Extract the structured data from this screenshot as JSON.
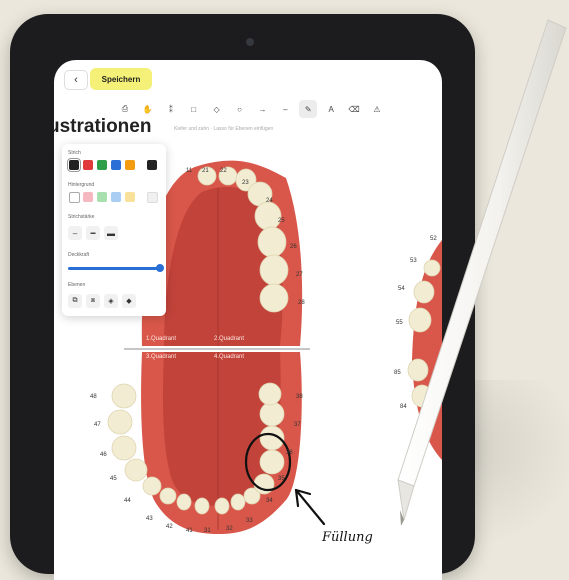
{
  "toolbar": {
    "back_glyph": "‹",
    "save_label": "Speichern",
    "tools": [
      "⎙",
      "✋",
      "⁑",
      "□",
      "◇",
      "○",
      "→",
      "–",
      "✎",
      "A",
      "⌫",
      "⚠"
    ],
    "hint": "Kiefer und zahn · Lasso für Ebenen einfügen"
  },
  "title": "ustrationen",
  "panel": {
    "stroke_label": "Strich",
    "stroke_colors": [
      "#222222",
      "#e03a3a",
      "#2e9e49",
      "#2a6fd6",
      "#f39c12",
      "#222222"
    ],
    "fill_label": "Hintergrund",
    "fill_colors": [
      "#ffffff",
      "#f6b8c0",
      "#a8e0b0",
      "#a9cdf3",
      "#f7e19b",
      "#f0f0f0"
    ],
    "width_label": "Strichstärke",
    "width_glyphs": [
      "–",
      "━",
      "▬"
    ],
    "opacity_label": "Deckkraft",
    "opacity_value": 1.0,
    "layers_label": "Ebenen",
    "layer_glyphs": [
      "⧉",
      "⧈",
      "◈",
      "◆"
    ]
  },
  "quadrants": [
    "1.Quadrant",
    "2.Quadrant",
    "3.Quadrant",
    "4.Quadrant"
  ],
  "tooth_numbers": {
    "upper_mid": [
      "11",
      "21",
      "22",
      "23",
      "24",
      "25",
      "26",
      "27",
      "28"
    ],
    "lower_left": [
      "48",
      "47",
      "46",
      "45",
      "44",
      "43",
      "42",
      "41"
    ],
    "lower_right": [
      "31",
      "32",
      "33",
      "34",
      "35",
      "36",
      "37",
      "38"
    ],
    "right_jaw": [
      "52",
      "53",
      "54",
      "55",
      "85",
      "84"
    ]
  },
  "annotation": "Füllung",
  "colors": {
    "gum": "#d9574a",
    "gum_dark": "#c2433a",
    "tooth": "#f2ecd3",
    "save": "#f4f078",
    "accent": "#2a6fd6"
  }
}
